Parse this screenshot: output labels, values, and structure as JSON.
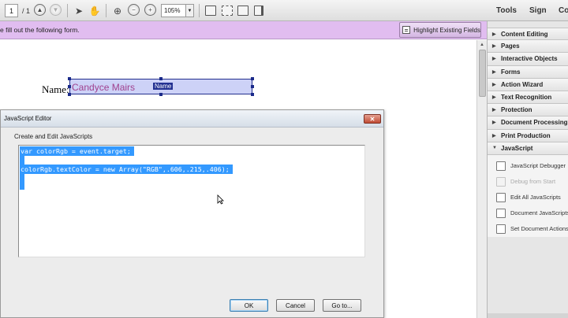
{
  "toolbar": {
    "page_current": "1",
    "page_total": "/ 1",
    "zoom": "105%",
    "prev_icon": "page-up-icon",
    "next_icon": "page-down-icon",
    "links": {
      "tools": "Tools",
      "sign": "Sign",
      "comment": "Co"
    }
  },
  "form_bar": {
    "message": "e fill out the following form.",
    "highlight_button": "Highlight Existing Fields"
  },
  "document": {
    "name_label": "Name:",
    "name_value": "Candyce Mairs",
    "field_tag": "Name"
  },
  "right_panel": {
    "sections": [
      "Content Editing",
      "Pages",
      "Interactive Objects",
      "Forms",
      "Action Wizard",
      "Text Recognition",
      "Protection",
      "Document Processing",
      "Print Production"
    ],
    "open_section": "JavaScript",
    "js_items": [
      {
        "label": "JavaScript Debugger",
        "enabled": true
      },
      {
        "label": "Debug from Start",
        "enabled": false
      },
      {
        "label": "Edit All JavaScripts",
        "enabled": true
      },
      {
        "label": "Document JavaScripts",
        "enabled": true
      },
      {
        "label": "Set Document Actions",
        "enabled": true
      }
    ]
  },
  "dialog": {
    "title": "JavaScript Editor",
    "close": "✕",
    "subtitle": "Create and Edit JavaScripts",
    "code": {
      "line1": "var colorRgb = event.target;",
      "line3": "colorRgb.textColor = new Array(\"RGB\",.606,.215,.406);"
    },
    "buttons": {
      "ok": "OK",
      "cancel": "Cancel",
      "goto": "Go to..."
    }
  }
}
